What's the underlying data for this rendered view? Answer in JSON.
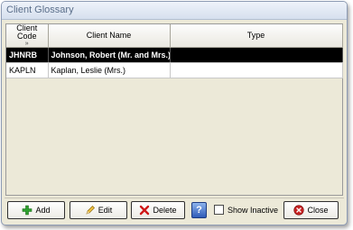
{
  "window": {
    "title": "Client Glossary"
  },
  "grid": {
    "columns": [
      {
        "label": "Client Code",
        "sort_indicator": "»"
      },
      {
        "label": "Client Name"
      },
      {
        "label": "Type"
      }
    ],
    "rows": [
      {
        "code": "JHNRB",
        "name": "Johnson, Robert (Mr. and Mrs.)",
        "type": "",
        "selected": true
      },
      {
        "code": "KAPLN",
        "name": "Kaplan, Leslie (Mrs.)",
        "type": "",
        "selected": false
      }
    ]
  },
  "toolbar": {
    "add_label": "Add",
    "edit_label": "Edit",
    "delete_label": "Delete",
    "help_label": "?",
    "show_inactive_label": "Show Inactive",
    "show_inactive_checked": false,
    "close_label": "Close"
  },
  "colors": {
    "selected_row_bg": "#000000",
    "window_bg": "#ece9d8",
    "help_button": "#2e5bb8"
  }
}
